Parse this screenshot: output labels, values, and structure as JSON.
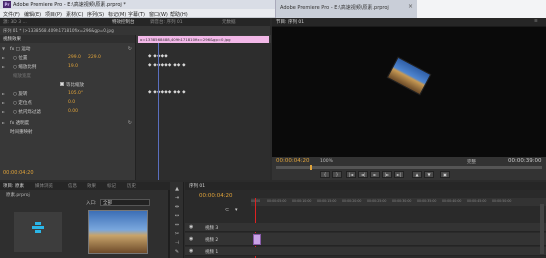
{
  "title_bar": {
    "app_badge": "Pr",
    "title": "Adobe Premiere Pro - E:\\高速视频\\原素.prproj *"
  },
  "browser_tab": {
    "title": "Adobe Premiere Pro - E:\\高速视频\\原素.prproj"
  },
  "menu": [
    "文件(F)",
    "编辑(E)",
    "项目(P)",
    "素材(C)",
    "序列(S)",
    "标记(M)",
    "字幕(T)",
    "窗口(W)",
    "帮助(H)"
  ],
  "effect_controls": {
    "tabs": [
      "源: 3D 3 ...",
      "特效控制台",
      "调音台: 序列 01",
      "元数据"
    ],
    "source_path": "序列 01 * (>1338568.409h171810fix=296&gp=0.jpg",
    "clip_label": "序列 01 * (>1338568.409h171810fix=296&gp=0.jpg",
    "pink_clip_text": "o=1338568488,409h171810fix=296&gp=0.jpg",
    "section_video": "视频效果",
    "rows": [
      {
        "label": "fx □ 运动",
        "value": "",
        "value2": ""
      },
      {
        "label": "○ 位置",
        "value": "299.0",
        "value2": "229.0"
      },
      {
        "label": "○ 缩放比例",
        "value": "19.0",
        "value2": ""
      },
      {
        "label": "缩放宽度",
        "value": "",
        "value2": ""
      },
      {
        "label": "等比缩放",
        "value": "",
        "value2": ""
      },
      {
        "label": "○ 旋转",
        "value": "105.0°",
        "value2": ""
      },
      {
        "label": "○ 定位点",
        "value": "0.0",
        "value2": ""
      },
      {
        "label": "○ 抗闪烁过滤",
        "value": "0.00",
        "value2": ""
      },
      {
        "label": "fx 透明度",
        "value": "",
        "value2": ""
      },
      {
        "label": "时间重映射",
        "value": "",
        "value2": ""
      }
    ],
    "timecode": "00:00:04:20"
  },
  "program_monitor": {
    "tabs": [
      "节目: 序列 01",
      "≡"
    ],
    "timecode_current": "00:00:04:20",
    "zoom": "100%",
    "fit": "完整",
    "timecode_duration": "00:00:39:00"
  },
  "project": {
    "tabs": [
      "项目: 原素",
      "媒体浏览",
      "信息",
      "效果",
      "标记",
      "历史"
    ],
    "filename": "原素.prproj",
    "in_label": "入口:",
    "in_value": "全部"
  },
  "timeline": {
    "tab": "序列 01",
    "timecode": "00:00:04:20",
    "ticks": [
      "00:00",
      "00:00:05:00",
      "00:00:10:00",
      "00:00:15:00",
      "00:00:20:00",
      "00:00:25:00",
      "00:00:30:00",
      "00:00:35:00",
      "00:00:40:00",
      "00:00:45:00",
      "00:00:50:00"
    ],
    "tracks": [
      {
        "name": "视频 3"
      },
      {
        "name": "视频 2"
      },
      {
        "name": "视频 1"
      }
    ]
  },
  "colors": {
    "accent_orange": "#e0a33a",
    "clip_pink": "#f2b8e8",
    "playhead_red": "#d22"
  }
}
